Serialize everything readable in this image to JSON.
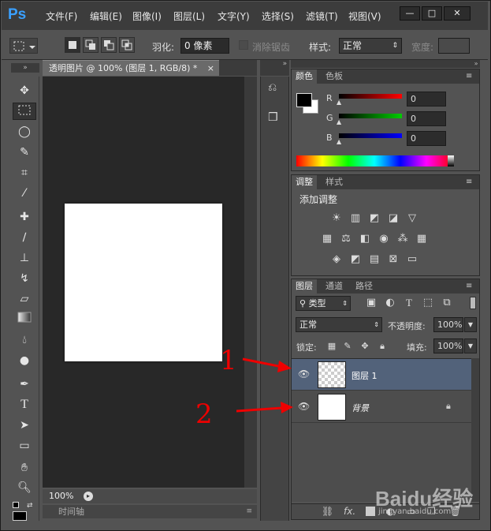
{
  "app": {
    "logo": "Ps"
  },
  "menu": [
    "文件(F)",
    "编辑(E)",
    "图像(I)",
    "图层(L)",
    "文字(Y)",
    "选择(S)",
    "滤镜(T)",
    "视图(V)"
  ],
  "window_controls": {
    "minimize": "▼",
    "restore": "—",
    "maximize": "□",
    "close": "✕"
  },
  "options": {
    "feather_label": "羽化:",
    "feather_value": "0 像素",
    "antialias_label": "消除锯齿",
    "style_label": "样式:",
    "style_value": "正常",
    "width_label": "宽度:"
  },
  "document": {
    "tab_title": "透明图片 @ 100% (图层 1, RGB/8) *",
    "zoom": "100%",
    "timeline_label": "时间轴"
  },
  "color_panel": {
    "tabs": [
      "颜色",
      "色板"
    ],
    "channels": [
      {
        "name": "R",
        "value": "0"
      },
      {
        "name": "G",
        "value": "0"
      },
      {
        "name": "B",
        "value": "0"
      }
    ]
  },
  "adjust_panel": {
    "tabs": [
      "调整",
      "样式"
    ],
    "heading": "添加调整"
  },
  "layers_panel": {
    "tabs": [
      "图层",
      "通道",
      "路径"
    ],
    "filter_label": "类型",
    "blend_mode": "正常",
    "opacity_label": "不透明度:",
    "opacity_value": "100%",
    "lock_label": "锁定:",
    "fill_label": "填充:",
    "fill_value": "100%",
    "layers": [
      {
        "name": "图层 1",
        "selected": true,
        "transparent": true
      },
      {
        "name": "背景",
        "selected": false,
        "locked": true
      }
    ],
    "footer_fx": "fx."
  },
  "annotations": {
    "label_1": "1",
    "label_2": "2"
  },
  "watermark": {
    "text": "Baidu经验",
    "sub": "jingyan.baidu.com"
  },
  "colors": {
    "accent_red": "#ee0000",
    "selected_layer": "#52627a"
  }
}
